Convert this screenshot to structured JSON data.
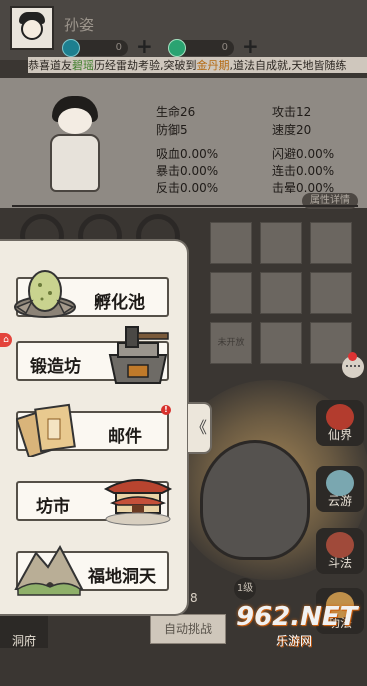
{
  "player": {
    "name": "孙姿"
  },
  "currency": {
    "coin": "0",
    "jade": "0",
    "plus": "+"
  },
  "marquee": {
    "prefix": "恭喜道友",
    "name": "碧瑶",
    "middle": "历经雷劫考验,突破到",
    "realm": "金丹期",
    "suffix": ",道法自成就,天地皆随练"
  },
  "stats": [
    {
      "label": "生命",
      "value": "26"
    },
    {
      "label": "攻击",
      "value": "12"
    },
    {
      "label": "防御",
      "value": "5"
    },
    {
      "label": "速度",
      "value": "20"
    },
    {
      "label": "吸血",
      "value": "0.00%"
    },
    {
      "label": "闪避",
      "value": "0.00%"
    },
    {
      "label": "暴击",
      "value": "0.00%"
    },
    {
      "label": "连击",
      "value": "0.00%"
    },
    {
      "label": "反击",
      "value": "0.00%"
    },
    {
      "label": "击晕",
      "value": "0.00%"
    }
  ],
  "detail_button": "属性详情",
  "equip_slot_locked": "未开放",
  "menu": {
    "items": [
      {
        "label": "孵化池",
        "icon": "egg-nest-icon"
      },
      {
        "label": "锻造坊",
        "icon": "anvil-icon"
      },
      {
        "label": "邮件",
        "icon": "scroll-mail-icon",
        "badge": "!"
      },
      {
        "label": "坊市",
        "icon": "market-pavilion-icon"
      },
      {
        "label": "福地洞天",
        "icon": "mountain-cave-icon"
      }
    ],
    "collapse_glyph": "《"
  },
  "side_menu": [
    {
      "label": "仙界",
      "icon": "gate-icon"
    },
    {
      "label": "云游",
      "icon": "cloud-icon"
    },
    {
      "label": "斗法",
      "icon": "sword-icon"
    },
    {
      "label": "功法",
      "icon": "book-icon"
    }
  ],
  "bottom": {
    "dongfu": "洞府",
    "auto_battle": "自动挑战",
    "stage": "8",
    "level": "1级"
  },
  "watermark": {
    "logo": "962.NET",
    "sub": "乐游网"
  },
  "colors": {
    "accent_red": "#d8312c",
    "text_green": "#3f7f2c",
    "text_gold": "#b46a13"
  }
}
